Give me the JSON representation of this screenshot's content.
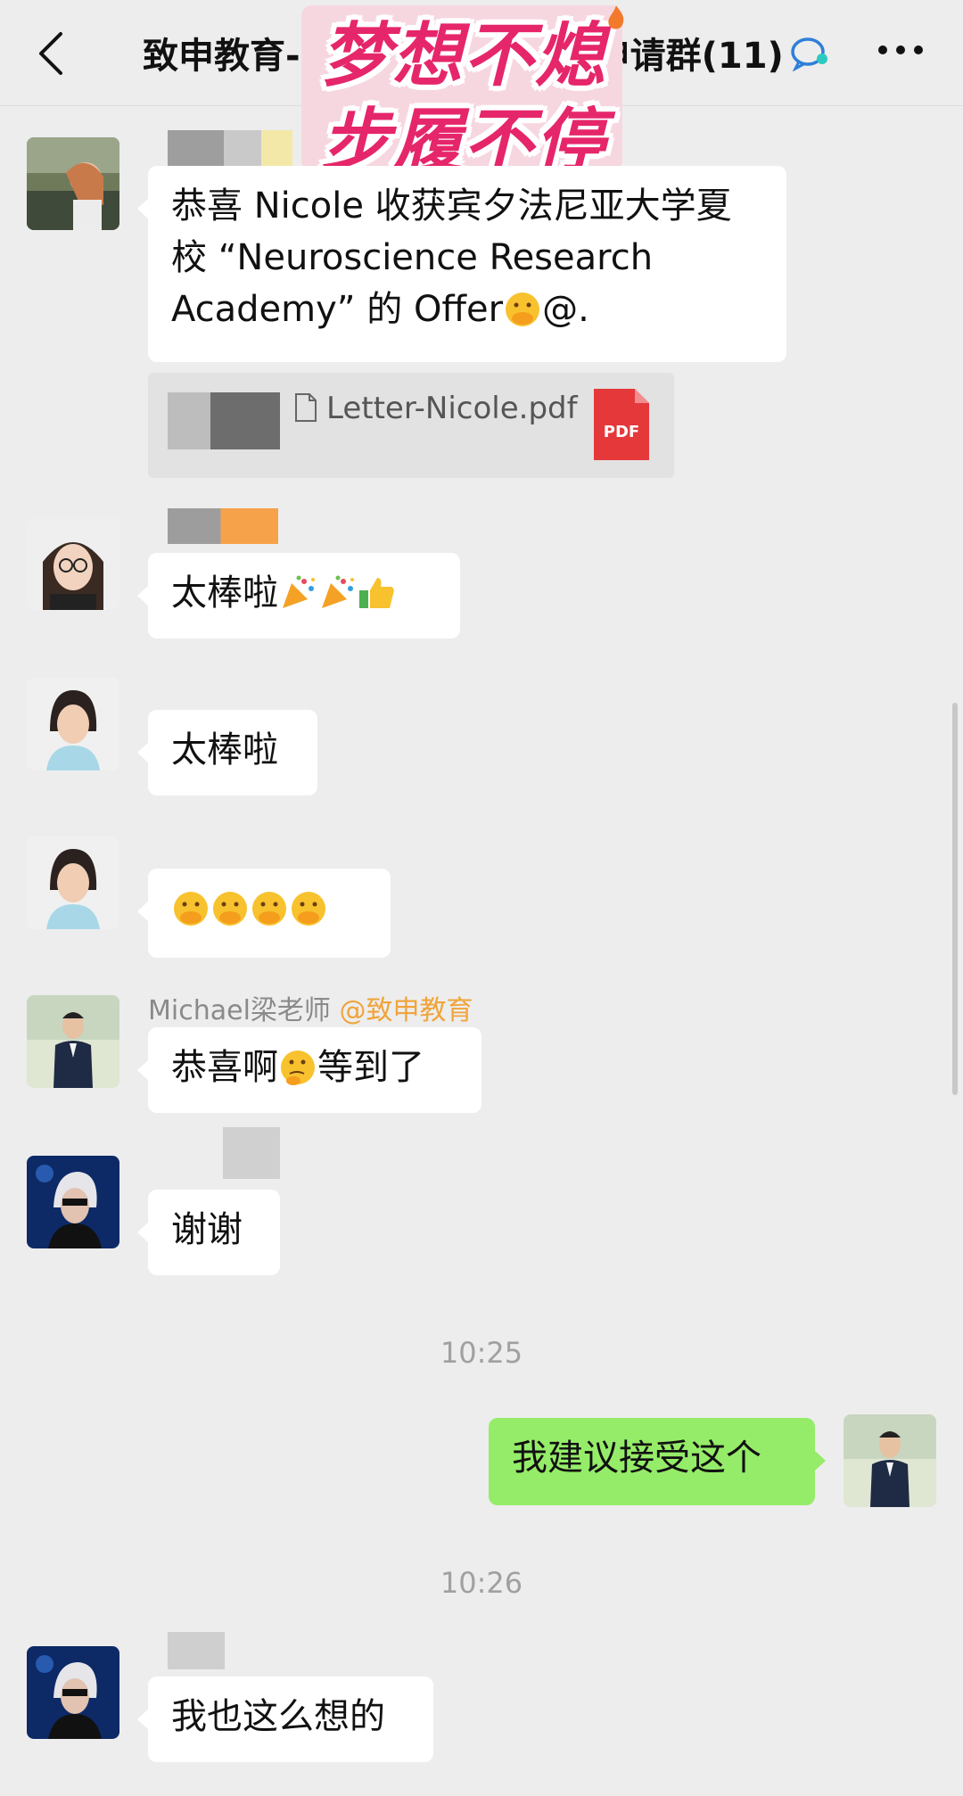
{
  "header": {
    "title": "致申教育-",
    "title_suffix": "申请群",
    "member_count": "(11)",
    "back_icon": "chevron-left-icon",
    "more_icon": "more-dots-icon",
    "group_icon": "chat-bubble-icon"
  },
  "slogan": {
    "line1": "梦想不熄",
    "line2": "步履不停"
  },
  "messages": [
    {
      "text": "恭喜 Nicole 收获宾夕法尼亚大学夏校 “Neuroscience Research Academy” 的 Offer",
      "line1": "恭喜 Nicole 收获宾夕法尼亚大学夏",
      "line2": "校 “Neuroscience Research",
      "line3": "Academy” 的 Offer",
      "suffix": "@."
    },
    {
      "file_name": "Letter-Nicole.pdf",
      "file_type": "PDF"
    },
    {
      "text": "太棒啦"
    },
    {
      "text": "太棒啦"
    },
    {
      "text": ""
    },
    {
      "sender": "Michael梁老师",
      "sender_org": "@致申教育",
      "text_before": "恭喜啊",
      "text_after": "等到了"
    },
    {
      "text": "谢谢"
    },
    {
      "time": "10:25"
    },
    {
      "text": "我建议接受这个",
      "from_me": true
    },
    {
      "time": "10:26"
    },
    {
      "text": "我也这么想的"
    }
  ],
  "colors": {
    "background": "#ededed",
    "bubble_other": "#ffffff",
    "bubble_me": "#95ec69",
    "slogan_pink": "#e6266a",
    "org_orange": "#f0a43a"
  }
}
